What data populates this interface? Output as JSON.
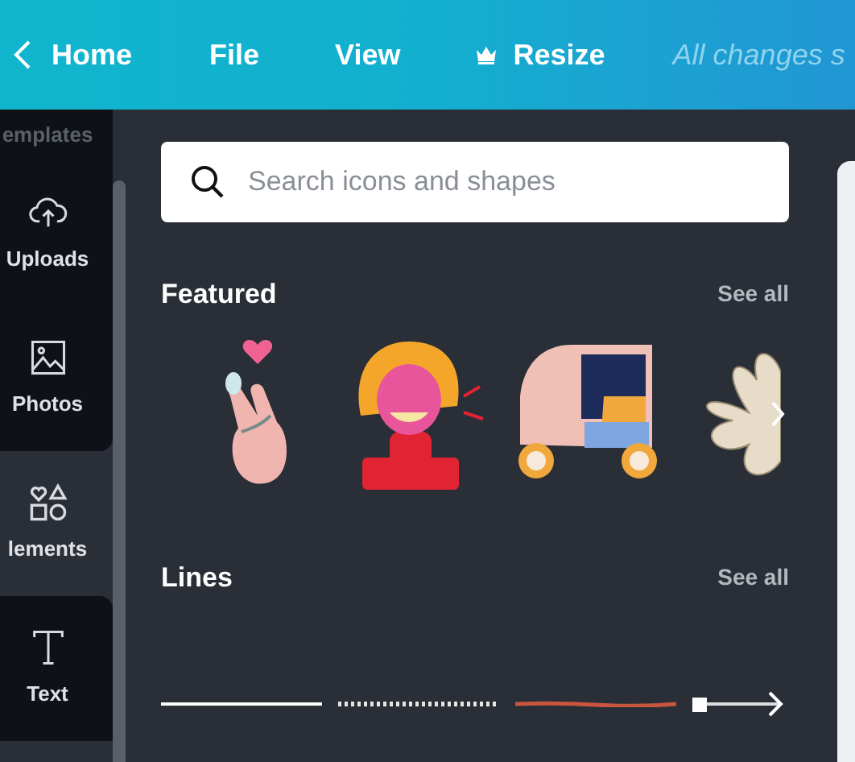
{
  "top_bar": {
    "back": "Home",
    "menu": [
      "File",
      "View"
    ],
    "resize": "Resize",
    "status": "All changes s"
  },
  "sidebar": {
    "items": [
      {
        "kind": "templates",
        "label": "emplates",
        "selected": false
      },
      {
        "kind": "uploads",
        "label": "Uploads",
        "selected": false
      },
      {
        "kind": "photos",
        "label": "Photos",
        "selected": false
      },
      {
        "kind": "elements",
        "label": "lements",
        "selected": true
      },
      {
        "kind": "text",
        "label": "Text",
        "selected": false
      }
    ]
  },
  "search": {
    "placeholder": "Search icons and shapes"
  },
  "sections": [
    {
      "kind": "featured",
      "title": "Featured",
      "see_all": "See all",
      "items": [
        {
          "kind": "hand"
        },
        {
          "kind": "woman"
        },
        {
          "kind": "rickshaw"
        },
        {
          "kind": "flower"
        }
      ]
    },
    {
      "kind": "lines",
      "title": "Lines",
      "see_all": "See all",
      "items": [
        {
          "kind": "solid"
        },
        {
          "kind": "dotted"
        },
        {
          "kind": "brush"
        },
        {
          "kind": "arrow"
        }
      ]
    }
  ]
}
